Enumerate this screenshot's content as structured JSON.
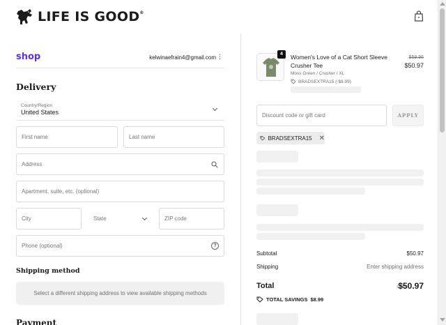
{
  "header": {
    "brand": "LIFE IS GOOD",
    "brand_mark": "®",
    "icons": {
      "logo": "dog-jake-logo",
      "cart": "shopping-bag-icon"
    }
  },
  "account": {
    "shop_label": "shop",
    "email": "kelwinaefrain4@gmail.com",
    "menu_glyph": "⋮"
  },
  "delivery": {
    "heading": "Delivery",
    "country_label": "Country/Region",
    "country_value": "United States",
    "first_name_ph": "First name",
    "last_name_ph": "Last name",
    "address_ph": "Address",
    "apartment_ph": "Apartment, suite, etc. (optional)",
    "city_ph": "City",
    "state_ph": "State",
    "zip_ph": "ZIP code",
    "phone_ph": "Phone (optional)",
    "help_glyph": "?"
  },
  "shipping": {
    "heading": "Shipping method",
    "message": "Select a different shipping address to view available shipping methods"
  },
  "payment": {
    "heading": "Payment"
  },
  "product": {
    "quantity": "4",
    "name": "Women's Love of a Cat Short Sleeve Crusher Tee",
    "variant": "Moss Green / Crusher / XL",
    "discount_tag": "BRADSEXTRA15 (-$8.99)",
    "original_price": "$59.96",
    "price": "$50.97",
    "color": "#7a8a6a"
  },
  "discount": {
    "placeholder": "Discount code or gift card",
    "apply_label": "APPLY",
    "applied_code": "BRADSEXTRA15",
    "remove_glyph": "✕"
  },
  "summary": {
    "subtotal_label": "Subtotal",
    "subtotal_value": "$50.97",
    "shipping_label": "Shipping",
    "shipping_value": "Enter shipping address",
    "total_label": "Total",
    "currency": "USD",
    "total_value": "$50.97",
    "savings_label": "TOTAL SAVINGS",
    "savings_value": "$8.99"
  }
}
